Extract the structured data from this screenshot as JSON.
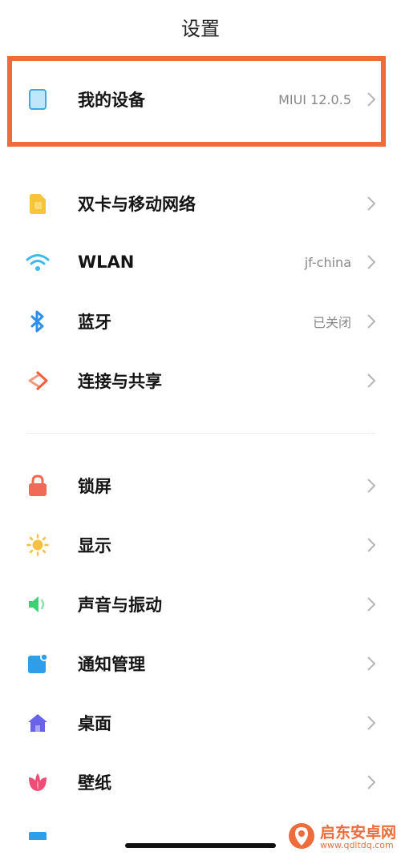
{
  "header": {
    "title": "设置"
  },
  "device_row": {
    "label": "我的设备",
    "value": "MIUI 12.0.5"
  },
  "connectivity": [
    {
      "label": "双卡与移动网络",
      "value": "",
      "icon": "sim-card-icon",
      "color": "#f5c43b"
    },
    {
      "label": "WLAN",
      "value": "jf-china",
      "icon": "wifi-icon",
      "color": "#3fb9e9"
    },
    {
      "label": "蓝牙",
      "value": "已关闭",
      "icon": "bluetooth-icon",
      "color": "#2f8fe8"
    },
    {
      "label": "连接与共享",
      "value": "",
      "icon": "share-connection-icon",
      "color": "#f05e3b"
    }
  ],
  "personal": [
    {
      "label": "锁屏",
      "icon": "lock-icon",
      "color": "#f06a55"
    },
    {
      "label": "显示",
      "icon": "sun-icon",
      "color": "#f5c043"
    },
    {
      "label": "声音与振动",
      "icon": "speaker-icon",
      "color": "#3fcf74"
    },
    {
      "label": "通知管理",
      "icon": "notification-icon",
      "color": "#2e9ee8"
    },
    {
      "label": "桌面",
      "icon": "home-icon",
      "color": "#6a62e8"
    },
    {
      "label": "壁纸",
      "icon": "flower-icon",
      "color": "#ef4d76"
    }
  ],
  "watermark": {
    "name": "启东安卓网",
    "url": "www.qdltdq.com"
  },
  "colors": {
    "highlight": "#ef6b3a",
    "chevron": "#b5b5b5"
  }
}
